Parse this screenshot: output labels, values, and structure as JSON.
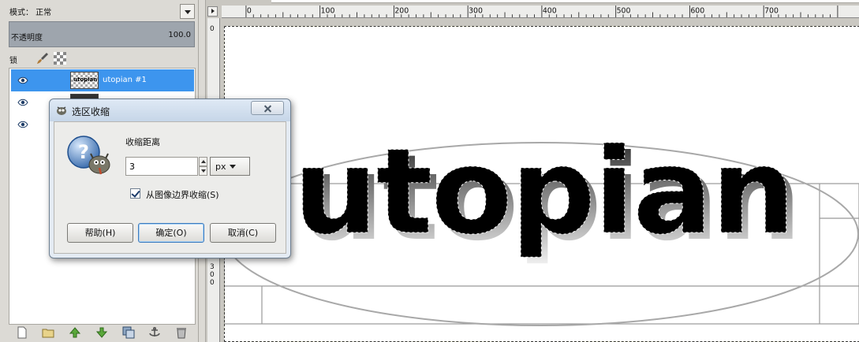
{
  "layers_panel": {
    "mode_label": "模式：  正常",
    "opacity_label": "不透明度",
    "opacity_value": "100.0",
    "lock_label": "锁定：",
    "layers": [
      {
        "name": "utopian #1",
        "thumb_text": "utopian",
        "selected": true
      },
      {
        "name": "",
        "thumb_text": "",
        "selected": false
      },
      {
        "name": "",
        "thumb_text": "",
        "selected": false
      }
    ],
    "toolbar_icons": [
      "new-layer-icon",
      "layer-group-icon",
      "raise-layer-icon",
      "lower-layer-icon",
      "duplicate-layer-icon",
      "anchor-layer-icon",
      "delete-layer-icon"
    ]
  },
  "rulers": {
    "h_labels": [
      "0",
      "100",
      "200",
      "300",
      "400",
      "500",
      "600",
      "700"
    ],
    "v_top_label": "0",
    "v_mid_label": [
      "3",
      "0",
      "0"
    ]
  },
  "canvas": {
    "text": "utopian"
  },
  "dialog": {
    "title": "选区收缩",
    "shrink_label": "收缩距离",
    "shrink_value": "3",
    "unit": "px",
    "checkbox_label": "从图像边界收缩(S)",
    "checkbox_checked": true,
    "help_button": "帮助(H)",
    "ok_button": "确定(O)",
    "cancel_button": "取消(C)"
  },
  "colors": {
    "selected_layer": "#3d95ee",
    "dialog_frame": "#e4ebf3"
  }
}
